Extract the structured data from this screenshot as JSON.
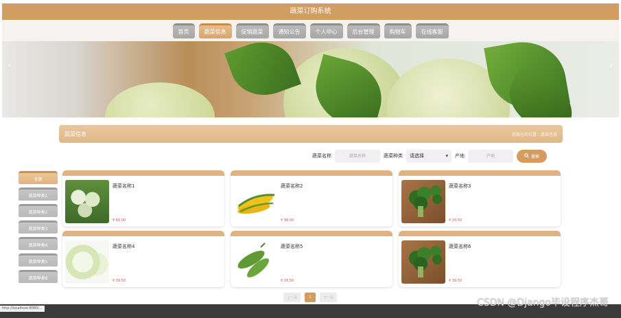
{
  "title": "蔬菜订购系统",
  "nav": [
    "首页",
    "蔬菜信息",
    "促销蔬菜",
    "通知公告",
    "个人中心",
    "后台管理",
    "购物车",
    "在线客服"
  ],
  "nav_active_index": 1,
  "section": {
    "title": "蔬菜信息",
    "breadcrumb": "您现在的位置：蔬菜信息"
  },
  "filters": {
    "name_label": "蔬菜名称",
    "name_placeholder": "蔬菜名称",
    "type_label": "蔬菜种类",
    "type_value": "请选择",
    "origin_label": "产地",
    "origin_placeholder": "产地",
    "search_label": "搜索"
  },
  "categories": [
    "全部",
    "蔬菜种类1",
    "蔬菜种类2",
    "蔬菜种类3",
    "蔬菜种类4",
    "蔬菜种类5",
    "蔬菜种类6"
  ],
  "products": [
    {
      "name": "蔬菜名称1",
      "price": "¥ 60.00",
      "img": "cabbage"
    },
    {
      "name": "蔬菜名称2",
      "price": "¥ 98.00",
      "img": "corn"
    },
    {
      "name": "蔬菜名称3",
      "price": "¥ 20.50",
      "img": "broccoli"
    },
    {
      "name": "蔬菜名称4",
      "price": "¥ 39.50",
      "img": "napa"
    },
    {
      "name": "蔬菜名称5",
      "price": "¥ 28.50",
      "img": "bitter"
    },
    {
      "name": "蔬菜名称6",
      "price": "¥ 39.50",
      "img": "broccoli"
    }
  ],
  "pager": {
    "prev": "上一页",
    "current": "1",
    "next": "下一页"
  },
  "status_url": "http://localhost:8080/...",
  "watermark": "CSDN @Django毕设程序杰哥",
  "colors": {
    "accent": "#d69b60",
    "nav_gray": "#b0b0b0",
    "header_tan": "#d09d62"
  }
}
